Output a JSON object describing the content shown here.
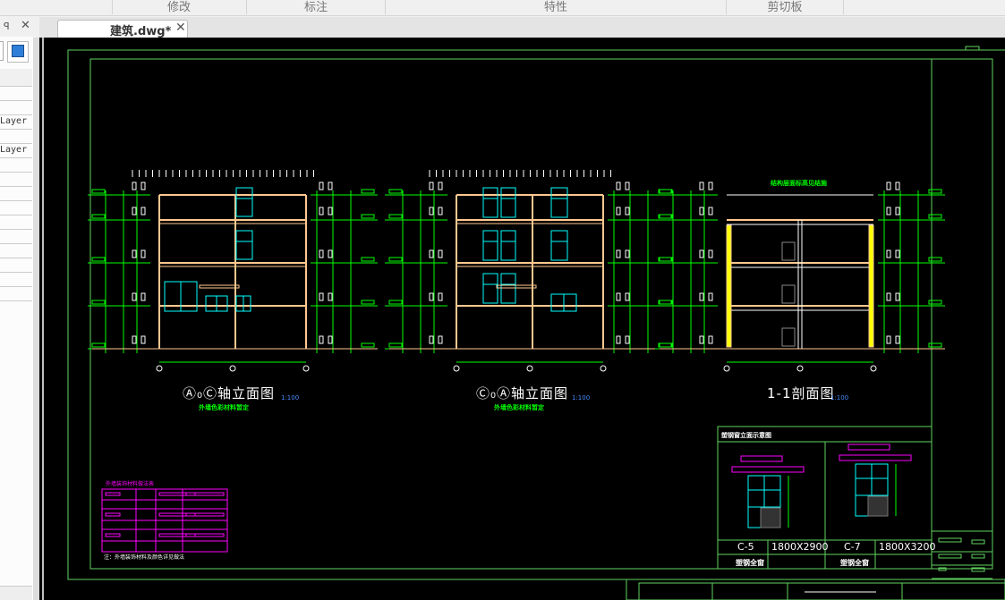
{
  "ribbon": {
    "groups": [
      "修改",
      "标注",
      "特性",
      "剪切板"
    ]
  },
  "left_panel": {
    "layer_labels": [
      "Layer",
      "Layer"
    ]
  },
  "tabs": [
    {
      "label": "建筑.dwg*",
      "active": true
    }
  ],
  "drawing": {
    "views": [
      {
        "title": "Ⓐ₀Ⓒ轴立面图",
        "scale": "1:100",
        "note": "外墙色彩材料暂定"
      },
      {
        "title": "Ⓒ₀Ⓐ轴立面图",
        "scale": "1:100",
        "note": "外墙色彩材料暂定"
      },
      {
        "title": "1-1剖面图",
        "scale": "1:100",
        "note": "结构层面标高见结施"
      }
    ],
    "window_schedule": {
      "heading": "塑钢窗立面示意图",
      "items": [
        {
          "code": "C-5",
          "size": "1800X2900",
          "material": "塑钢全窗"
        },
        {
          "code": "C-7",
          "size": "1800X3200",
          "material": "塑钢全窗"
        }
      ]
    },
    "legend_title": "外墙装饰材料做法表",
    "legend_footnote": "注：外墙装饰材料及颜色详见做法",
    "colors": {
      "frame": "#5fd35f",
      "dim": "#00ff00",
      "wall": "#ffc890",
      "window": "#00ffff",
      "table": "#ff00ff",
      "canvas": "#000000"
    }
  }
}
